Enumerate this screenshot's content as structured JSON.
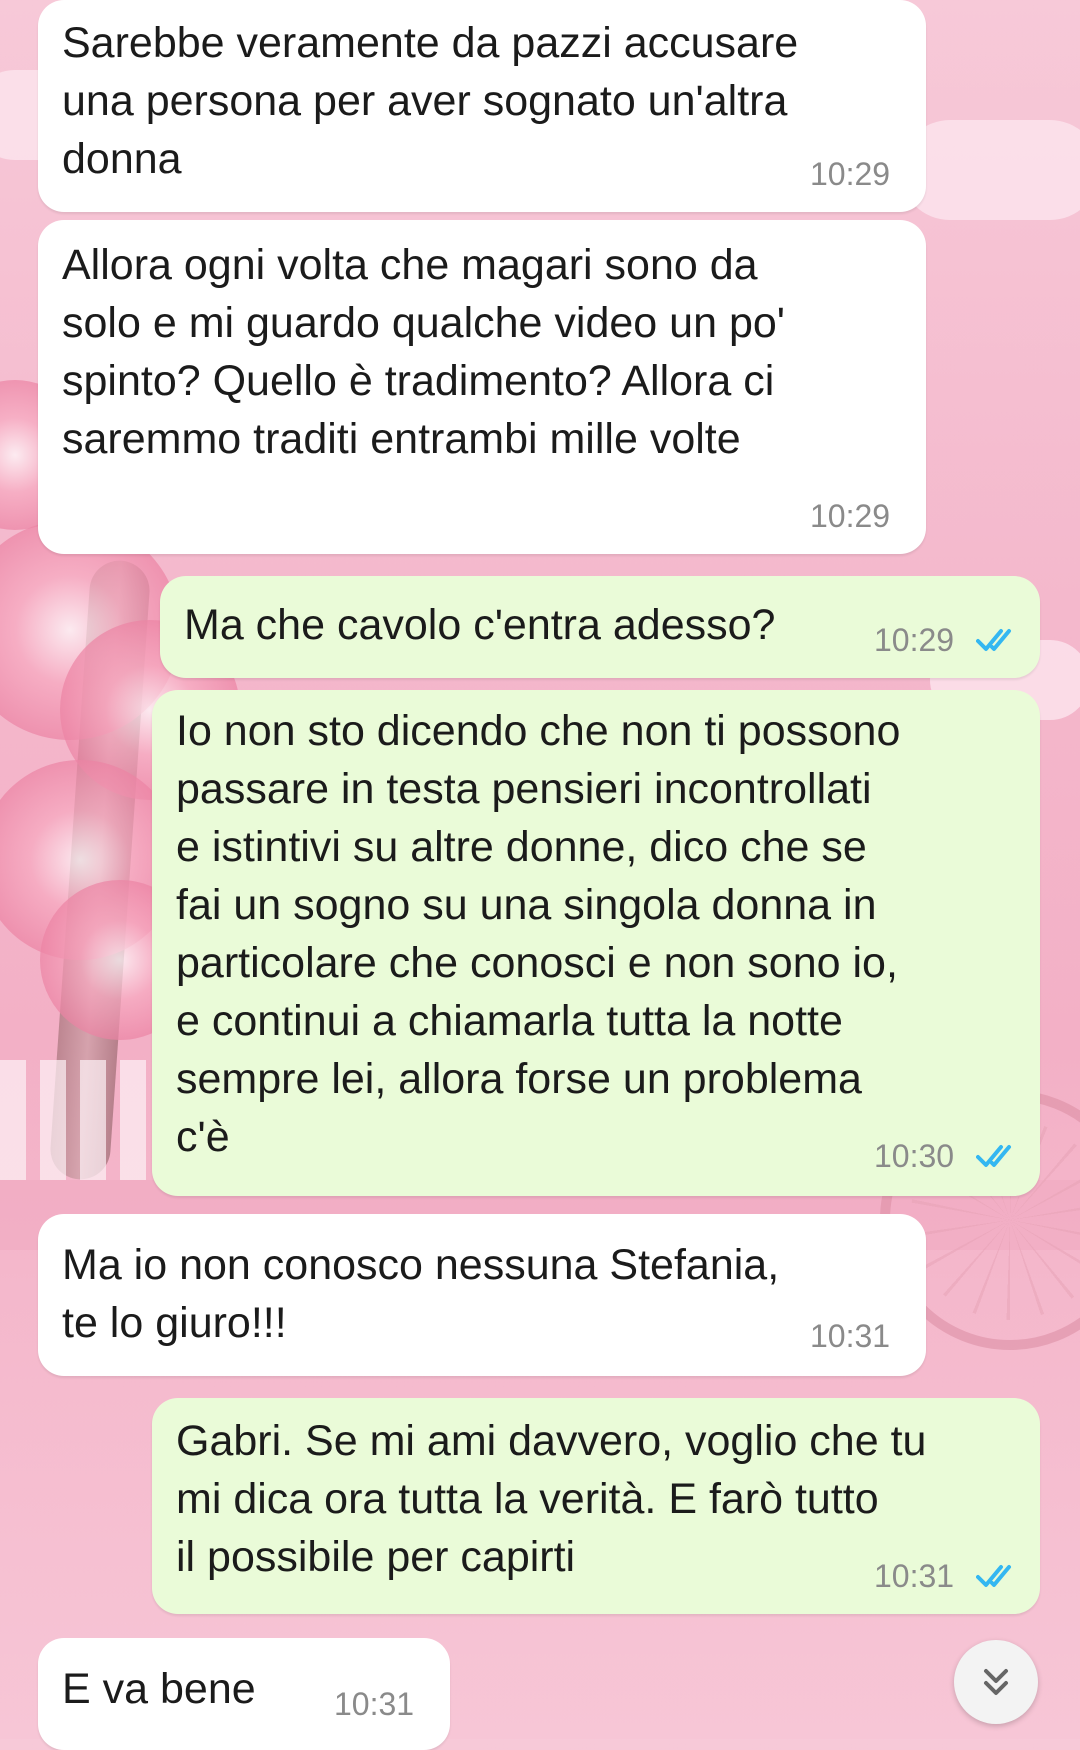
{
  "messages": [
    {
      "direction": "incoming",
      "text": "Sarebbe veramente da pazzi accusare\nuna persona per aver sognato un'altra\ndonna",
      "time": "10:29"
    },
    {
      "direction": "incoming",
      "text": "Allora ogni volta che magari sono da\nsolo e mi guardo qualche video un po'\nspinto? Quello è tradimento? Allora ci\nsaremmo traditi entrambi mille volte",
      "time": "10:29"
    },
    {
      "direction": "outgoing",
      "text": "Ma che cavolo c'entra adesso?",
      "time": "10:29",
      "status": "read"
    },
    {
      "direction": "outgoing",
      "text": "Io non sto dicendo che non ti possono\npassare in testa pensieri incontrollati\ne istintivi su altre donne, dico che se\nfai un sogno su una singola donna in\nparticolare che conosci e non sono io,\ne continui a chiamarla tutta la notte\nsempre lei, allora forse un problema\nc'è",
      "time": "10:30",
      "status": "read"
    },
    {
      "direction": "incoming",
      "text": "Ma io non conosco nessuna Stefania,\nte lo giuro!!!",
      "time": "10:31"
    },
    {
      "direction": "outgoing",
      "text": "Gabri. Se mi ami davvero, voglio che tu\nmi dica ora tutta la verità. E farò tutto\nil possibile per capirti",
      "time": "10:31",
      "status": "read"
    },
    {
      "direction": "incoming",
      "text": "E va bene",
      "time": "10:31"
    }
  ],
  "colors": {
    "incoming_bubble": "#ffffff",
    "outgoing_bubble": "#eafbd8",
    "read_ticks": "#34b7f1",
    "timestamp": "#8a8a8a"
  },
  "scroll_button": {
    "icon": "double-chevron-down-icon"
  }
}
